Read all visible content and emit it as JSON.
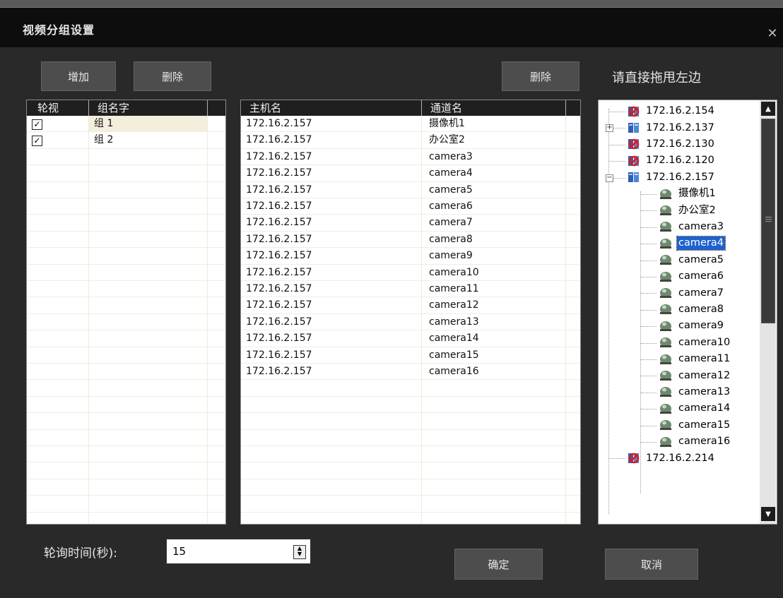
{
  "window": {
    "title": "视频分组设置"
  },
  "buttons": {
    "add": "增加",
    "delete_group": "删除",
    "delete_channel": "删除",
    "ok": "确定",
    "cancel": "取消"
  },
  "hint": "请直接拖甩左边",
  "groups": {
    "headers": [
      "轮视",
      "组名字"
    ],
    "rows": [
      {
        "checked": true,
        "name": "组 1"
      },
      {
        "checked": true,
        "name": "组 2"
      }
    ]
  },
  "channels": {
    "headers": [
      "主机名",
      "通道名"
    ],
    "rows": [
      [
        "172.16.2.157",
        "摄像机1"
      ],
      [
        "172.16.2.157",
        "办公室2"
      ],
      [
        "172.16.2.157",
        "camera3"
      ],
      [
        "172.16.2.157",
        "camera4"
      ],
      [
        "172.16.2.157",
        "camera5"
      ],
      [
        "172.16.2.157",
        "camera6"
      ],
      [
        "172.16.2.157",
        "camera7"
      ],
      [
        "172.16.2.157",
        "camera8"
      ],
      [
        "172.16.2.157",
        "camera9"
      ],
      [
        "172.16.2.157",
        "camera10"
      ],
      [
        "172.16.2.157",
        "camera11"
      ],
      [
        "172.16.2.157",
        "camera12"
      ],
      [
        "172.16.2.157",
        "camera13"
      ],
      [
        "172.16.2.157",
        "camera14"
      ],
      [
        "172.16.2.157",
        "camera15"
      ],
      [
        "172.16.2.157",
        "camera16"
      ]
    ]
  },
  "tree": {
    "items": [
      {
        "label": "172.16.2.154",
        "type": "host-offline",
        "level": 0
      },
      {
        "label": "172.16.2.137",
        "type": "host-online",
        "level": 0,
        "expander": "+"
      },
      {
        "label": "172.16.2.130",
        "type": "host-offline",
        "level": 0
      },
      {
        "label": "172.16.2.120",
        "type": "host-offline",
        "level": 0
      },
      {
        "label": "172.16.2.157",
        "type": "host-online",
        "level": 0,
        "expander": "−"
      },
      {
        "label": "摄像机1",
        "type": "camera",
        "level": 1
      },
      {
        "label": "办公室2",
        "type": "camera",
        "level": 1
      },
      {
        "label": "camera3",
        "type": "camera",
        "level": 1
      },
      {
        "label": "camera4",
        "type": "camera",
        "level": 1,
        "selected": true
      },
      {
        "label": "camera5",
        "type": "camera",
        "level": 1
      },
      {
        "label": "camera6",
        "type": "camera",
        "level": 1
      },
      {
        "label": "camera7",
        "type": "camera",
        "level": 1
      },
      {
        "label": "camera8",
        "type": "camera",
        "level": 1
      },
      {
        "label": "camera9",
        "type": "camera",
        "level": 1
      },
      {
        "label": "camera10",
        "type": "camera",
        "level": 1
      },
      {
        "label": "camera11",
        "type": "camera",
        "level": 1
      },
      {
        "label": "camera12",
        "type": "camera",
        "level": 1
      },
      {
        "label": "camera13",
        "type": "camera",
        "level": 1
      },
      {
        "label": "camera14",
        "type": "camera",
        "level": 1
      },
      {
        "label": "camera15",
        "type": "camera",
        "level": 1
      },
      {
        "label": "camera16",
        "type": "camera",
        "level": 1
      },
      {
        "label": "172.16.2.214",
        "type": "host-offline",
        "level": 0
      }
    ]
  },
  "polling": {
    "label": "轮询时间(秒):",
    "value": "15"
  },
  "colors": {
    "background": "#292929",
    "selection": "#1e62cf",
    "button": "#4d4d4d"
  }
}
